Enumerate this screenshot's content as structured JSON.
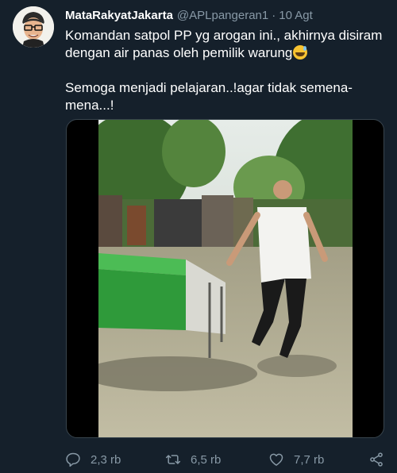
{
  "tweet": {
    "author_name": "MataRakyatJakarta",
    "author_handle": "@APLpangeran1",
    "separator": "·",
    "time": "10 Agt",
    "text_line1": "Komandan satpol PP yg arogan ini., akhirnya disiram dengan air panas oleh pemilik warung",
    "emoji": "grinning-face-with-sweat",
    "text_line2": "Semoga menjadi pelajaran..!agar tidak semena-mena...!"
  },
  "media": {
    "type": "video-still"
  },
  "actions": {
    "reply_count": "2,3 rb",
    "retweet_count": "6,5 rb",
    "like_count": "7,7 rb",
    "reply_icon": "reply-icon",
    "retweet_icon": "retweet-icon",
    "like_icon": "heart-icon",
    "share_icon": "share-icon"
  },
  "colors": {
    "background": "#15202b",
    "text": "#ffffff",
    "secondary": "#8899a6",
    "border": "#38444d"
  }
}
